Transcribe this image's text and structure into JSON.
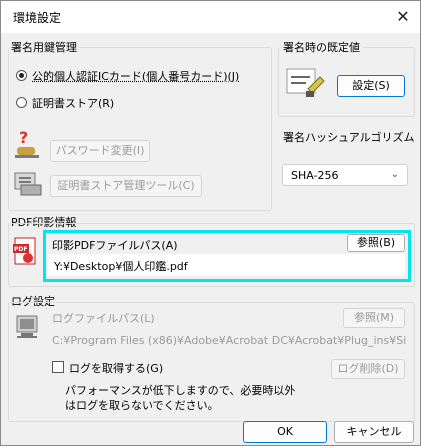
{
  "window": {
    "title": "環境設定",
    "close": "✕"
  },
  "signing_key": {
    "group_label": "署名用鍵管理",
    "option_mynumber": "公的個人認証ICカード(個人番号カード)(J)",
    "option_certstore": "証明書ストア(R)",
    "password_button": "パスワード変更(I)",
    "certstore_tool_button": "証明書ストア管理ツール(C)"
  },
  "default_signing": {
    "group_label": "署名時の既定値",
    "settings_button": "設定(S)"
  },
  "hash_algorithm": {
    "group_label": "署名ハッシュアルゴリズム",
    "selected": "SHA-256"
  },
  "pdf_stamp": {
    "group_label": "PDF印影情報",
    "path_label": "印影PDFファイルパス(A)",
    "browse_button": "参照(B)",
    "path_value": "Y:¥Desktop¥個人印鑑.pdf",
    "highlight_color": "#00e5ee"
  },
  "log": {
    "group_label": "ログ設定",
    "path_label": "ログファイルパス(L)",
    "browse_button": "参照(M)",
    "path_value": "C:¥Program Files (x86)¥Adobe¥Acrobat DC¥Acrobat¥Plug_ins¥SignedP",
    "enable_label": "ログを取得する(G)",
    "delete_button": "ログ削除(D)",
    "note_line1": "パフォーマンスが低下しますので、必要時以外",
    "note_line2": "はログを取らないでください。"
  },
  "footer": {
    "ok": "OK",
    "cancel": "キャンセル"
  }
}
